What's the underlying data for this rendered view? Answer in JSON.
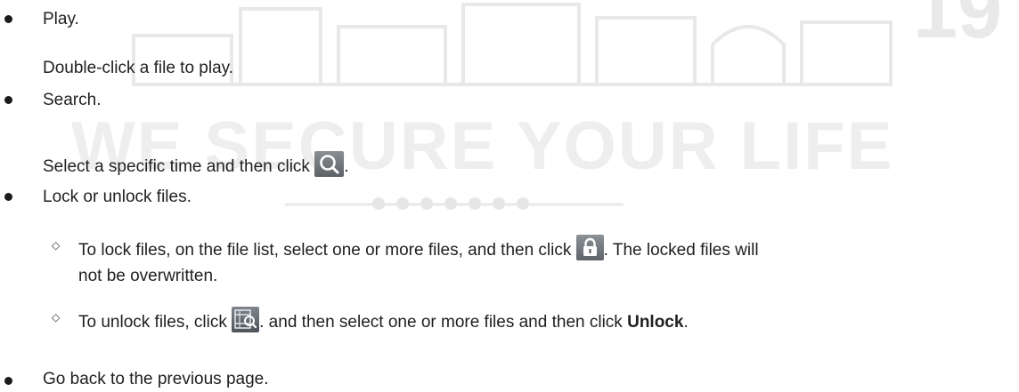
{
  "colors": {
    "text": "#1f1f1f",
    "watermark": "#ececec",
    "icon_bg": "#6b7075"
  },
  "watermark": {
    "slogan": "WE SECURE YOUR LIFE",
    "logo_fragment": "19"
  },
  "items": {
    "play": {
      "title": "Play.",
      "desc": "Double-click a file to play."
    },
    "search": {
      "title": "Search.",
      "desc_before": "Select a specific time and then click",
      "desc_after": ".",
      "icon": "search-icon"
    },
    "lock": {
      "title": "Lock or unlock files.",
      "sub1": {
        "before": "To lock files, on the file list, select one or more files, and then click",
        "after": ". The locked files will",
        "line2": "not be overwritten.",
        "icon": "lock-icon"
      },
      "sub2": {
        "before": "To unlock files, click",
        "middle": ". and then select one or more files and then click",
        "bold": "Unlock",
        "after": ".",
        "icon": "record-file-icon"
      }
    },
    "back": {
      "title": "Go back to the previous page."
    }
  }
}
